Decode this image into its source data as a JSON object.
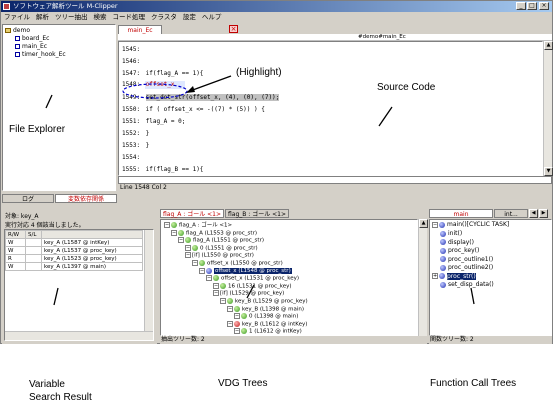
{
  "window": {
    "title": "ソフトウェア解析ツール M-Clipper",
    "controls": [
      "_",
      "□",
      "×"
    ]
  },
  "menu": [
    "ファイル",
    "解析",
    "ツリー抽出",
    "検索",
    "コード処理",
    "クラスタ",
    "設定",
    "ヘルプ"
  ],
  "explorer": {
    "root": "demo",
    "files": [
      "board_Ec",
      "main_Ec",
      "timer_hook_Ec"
    ]
  },
  "editor": {
    "tab": "main_Ec",
    "header_right": "#demo#main_Ec",
    "lines": [
      {
        "n": "1545:",
        "code": ""
      },
      {
        "n": "1546:",
        "code": ""
      },
      {
        "n": "1547:",
        "code": "if(flag_A == 1){"
      },
      {
        "n": "1548:",
        "code": "offset_x"
      },
      {
        "n": "1549:",
        "code": "set_dot_str(offset_x, (4), (0), (7));"
      },
      {
        "n": "1550:",
        "code": "if ( offset_x <= -((7) * (5)) ) {"
      },
      {
        "n": "1551:",
        "code": "flag_A = 0;"
      },
      {
        "n": "1552:",
        "code": "}"
      },
      {
        "n": "1553:",
        "code": "}"
      },
      {
        "n": "1554:",
        "code": ""
      },
      {
        "n": "1555:",
        "code": "if(flag_B == 1){"
      }
    ],
    "status": "Line 1548  Col 2"
  },
  "left_panel": {
    "tabs": [
      "ログ",
      "変数依存関係"
    ],
    "target_label": "対象: key_A",
    "result_label": "実行対応 4 個該当しました。",
    "columns": [
      "R/W",
      "S/L",
      ""
    ],
    "rows": [
      [
        "W",
        "",
        "key_A (L1587 @ intKey)"
      ],
      [
        "W",
        "",
        "key_A (L1537 @ proc_key)"
      ],
      [
        "R",
        "",
        "key_A (L1523 @ proc_key)"
      ],
      [
        "W",
        "",
        "key_A (L1397 @ main)"
      ]
    ]
  },
  "vdg": {
    "tabs": [
      "flag_A : ゴール <1>",
      "flag_B : ゴール <1>"
    ],
    "rows": [
      {
        "indent": 0,
        "text": "flag_A : ゴール <1>",
        "color": "green",
        "selected": false
      },
      {
        "indent": 1,
        "text": "flag_A (L1553 @ proc_str)",
        "color": "green",
        "selected": false
      },
      {
        "indent": 2,
        "text": "flag_A (L1551 @ proc_str)",
        "color": "green",
        "selected": false
      },
      {
        "indent": 3,
        "text": "0 (L1551 @ proc_str)",
        "color": "green",
        "selected": false
      },
      {
        "indent": 3,
        "text": "[if] (L1550 @ proc_str)",
        "color": "none",
        "selected": false
      },
      {
        "indent": 4,
        "text": "offset_x (L1550 @ proc_str)",
        "color": "green",
        "selected": false
      },
      {
        "indent": 5,
        "text": "offset_x (L1548 @ proc_str)",
        "color": "blue",
        "selected": true
      },
      {
        "indent": 6,
        "text": "offset_x (L1531 @ proc_key)",
        "color": "green",
        "selected": false
      },
      {
        "indent": 7,
        "text": "16 (L1531 @ proc_key)",
        "color": "green",
        "selected": false
      },
      {
        "indent": 7,
        "text": "[if] (L1529 @ proc_key)",
        "color": "none",
        "selected": false
      },
      {
        "indent": 8,
        "text": "key_B (L1529 @ proc_key)",
        "color": "green",
        "selected": false
      },
      {
        "indent": 9,
        "text": "key_B (L1398 @ main)",
        "color": "green",
        "selected": false
      },
      {
        "indent": 10,
        "text": "0 (L1398 @ main)",
        "color": "green",
        "selected": false
      },
      {
        "indent": 9,
        "text": "key_B (L1612 @ intKey)",
        "color": "red",
        "selected": false
      },
      {
        "indent": 10,
        "text": "1 (L1612 @ intKey)",
        "color": "green",
        "selected": false
      }
    ],
    "status": "抽出ツリー数: 2"
  },
  "funcs": {
    "tabs": [
      "main",
      "int..."
    ],
    "root": "main()[CYCLIC TASK]",
    "items": [
      "init()",
      "display()",
      "proc_key()",
      "proc_outline1()",
      "proc_outline2()",
      "proc_str()",
      "set_disp_data()"
    ],
    "selected_index": 5,
    "status": "関数ツリー数: 2"
  },
  "annotations": {
    "highlight": "(Highlight)",
    "source_code": "Source Code",
    "file_explorer": "File Explorer",
    "variable_search": "Variable Search Result",
    "vdg_trees": "VDG Trees",
    "function_call_trees": "Function Call Trees"
  }
}
